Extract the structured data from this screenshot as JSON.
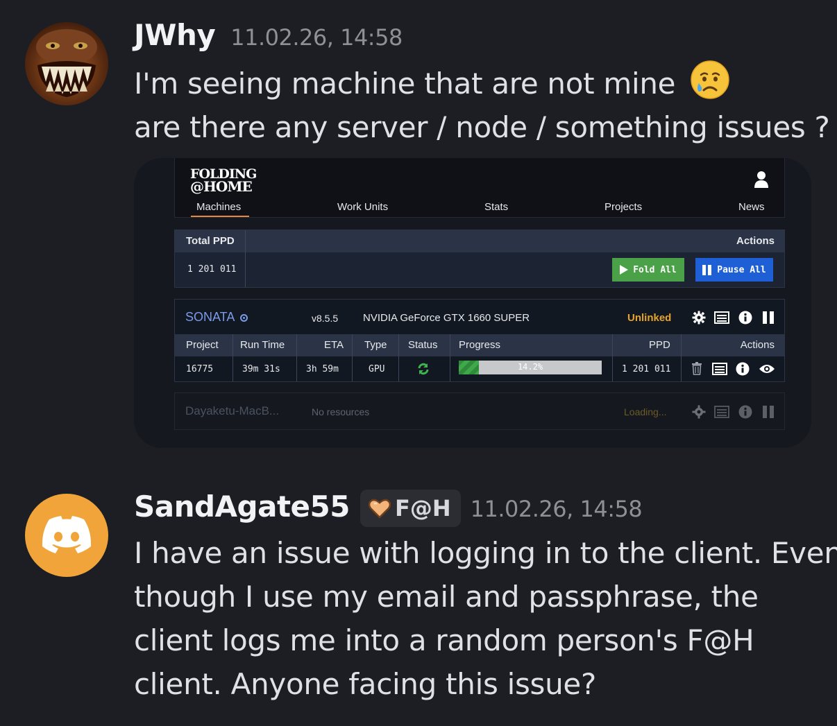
{
  "messages": [
    {
      "username": "JWhy",
      "timestamp": "11.02.26, 14:58",
      "lines": [
        "I'm seeing machine that are not mine",
        "are there any server / node / something issues ?"
      ],
      "emoji": "crying-face"
    },
    {
      "username": "SandAgate55",
      "tag": "F@H",
      "timestamp": "11.02.26, 14:58",
      "lines": [
        "I have an issue with logging in to the client. Even",
        "though I use my email and passphrase, the",
        "client logs me into a random person's F@H",
        "client. Anyone facing this issue?"
      ]
    }
  ],
  "fah": {
    "logo_line1": "FOLDING",
    "logo_line2": "@HOME",
    "nav": [
      "Machines",
      "Work Units",
      "Stats",
      "Projects",
      "News"
    ],
    "total": {
      "label": "Total PPD",
      "actions_label": "Actions",
      "value": "1 201 011",
      "fold_all": "Fold All",
      "pause_all": "Pause All"
    },
    "machine": {
      "name": "SONATA",
      "version": "v8.5.5",
      "gpu": "NVIDIA GeForce GTX 1660 SUPER",
      "status": "Unlinked",
      "columns": [
        "Project",
        "Run Time",
        "ETA",
        "Type",
        "Status",
        "Progress",
        "PPD",
        "Actions"
      ],
      "row": {
        "project": "16775",
        "run_time": "39m 31s",
        "eta": "3h 59m",
        "type": "GPU",
        "progress_label": "14.2%",
        "progress": 0.142,
        "ppd": "1 201 011"
      }
    },
    "machine2": {
      "name": "Dayaketu-MacB...",
      "resources": "No resources",
      "status": "Loading..."
    }
  },
  "colors": {
    "background": "#1d1e23",
    "fold_green": "#4aa147",
    "pause_blue": "#1f5fd6",
    "unlinked_orange": "#e8a42a",
    "machine_name": "#7a9be8",
    "avatar2": "#f0a43a"
  }
}
